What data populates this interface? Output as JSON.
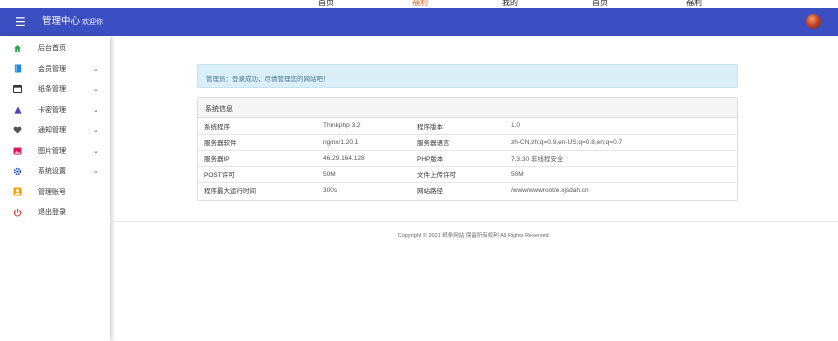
{
  "top_strip": {
    "items": [
      "首页",
      "福利",
      "我的",
      "首页",
      "福利"
    ]
  },
  "header": {
    "title": "管理中心",
    "welcome": "欢迎你"
  },
  "sidebar": {
    "items": [
      {
        "label": "后台首页",
        "icon": "home-icon",
        "color": "#2ea44f",
        "has_arrow": false
      },
      {
        "label": "会员管理",
        "icon": "book-icon",
        "color": "#1e88e5",
        "has_arrow": true
      },
      {
        "label": "纸条管理",
        "icon": "card-icon",
        "color": "#333333",
        "has_arrow": true
      },
      {
        "label": "卡密管理",
        "icon": "triangle-icon",
        "color": "#5b3cc4",
        "has_arrow": true
      },
      {
        "label": "通知管理",
        "icon": "heart-icon",
        "color": "#555555",
        "has_arrow": true
      },
      {
        "label": "图片管理",
        "icon": "image-icon",
        "color": "#d81b60",
        "has_arrow": true
      },
      {
        "label": "系统设置",
        "icon": "gear-icon",
        "color": "#1e4fc4",
        "has_arrow": true
      },
      {
        "label": "管理账号",
        "icon": "user-icon",
        "color": "#f59e0b",
        "has_arrow": false
      },
      {
        "label": "退出登录",
        "icon": "power-icon",
        "color": "#e53935",
        "has_arrow": false
      }
    ]
  },
  "alert": {
    "text": "管理员：登录成功，尽情管理您的网站吧！"
  },
  "sysinfo": {
    "title": "系统信息",
    "rows": [
      {
        "k1": "系统程序",
        "v1": "Thinkphp 3.2",
        "k2": "程序版本",
        "v2": "1.0"
      },
      {
        "k1": "服务器软件",
        "v1": "nginx/1.20.1",
        "k2": "服务器语言",
        "v2": "zh-CN,zh;q=0.9,en-US;q=0.8,en;q=0.7"
      },
      {
        "k1": "服务器IP",
        "v1": "46.29.164.128",
        "k2": "PHP版本",
        "v2": "7.3.30 非线程安全"
      },
      {
        "k1": "POST许可",
        "v1": "50M",
        "k2": "文件上传许可",
        "v2": "50M"
      },
      {
        "k1": "程序最大运行时间",
        "v1": "300s",
        "k2": "网站路径",
        "v2": "/www/wwwroot/e.xjsdah.cn"
      }
    ]
  },
  "footer": {
    "copyright": "Copyright © 2021 纸条网站 保留所有权利 All Rights Reserved."
  },
  "colors": {
    "header_bg": "#3b4ec2",
    "alert_bg": "#d9eef6"
  }
}
